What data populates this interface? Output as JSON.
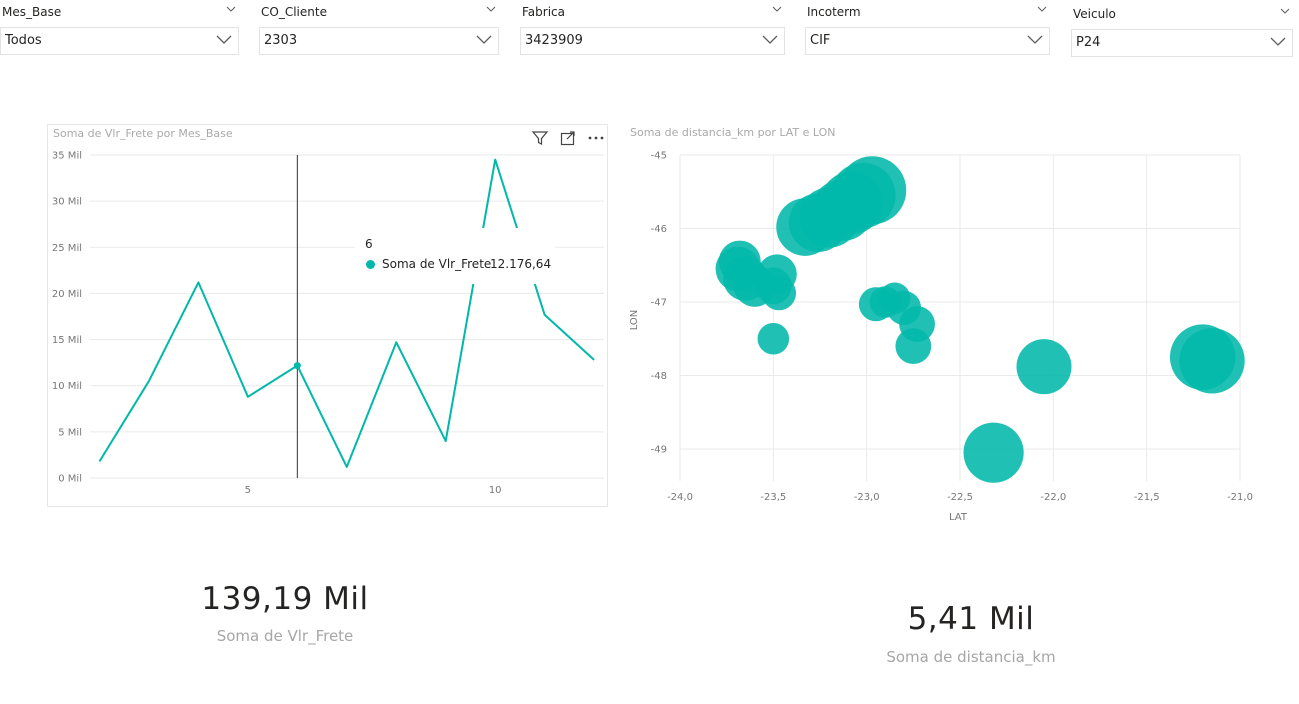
{
  "slicers": [
    {
      "label": "Mes_Base",
      "value": "Todos"
    },
    {
      "label": "CO_Cliente",
      "value": "2303"
    },
    {
      "label": "Fabrica",
      "value": "3423909"
    },
    {
      "label": "Incoterm",
      "value": "CIF"
    },
    {
      "label": "Veiculo",
      "value": "P24"
    }
  ],
  "line_chart": {
    "title": "Soma de Vlr_Frete por Mes_Base",
    "tooltip": {
      "header": "6",
      "series": "Soma de Vlr_Frete",
      "value": "12.176,64"
    }
  },
  "scatter_chart": {
    "title": "Soma de distancia_km por LAT e LON"
  },
  "cards": [
    {
      "value": "139,19 Mil",
      "label": "Soma de Vlr_Frete"
    },
    {
      "value": "5,41 Mil",
      "label": "Soma de distancia_km"
    }
  ],
  "colors": {
    "accent": "#01b8aa"
  },
  "icons": [
    "chevron-down-icon",
    "filter-icon",
    "focus-mode-icon",
    "more-options-icon"
  ],
  "chart_data": [
    {
      "type": "line",
      "title": "Soma de Vlr_Frete por Mes_Base",
      "x": [
        2,
        3,
        4,
        5,
        6,
        7,
        8,
        9,
        10,
        11,
        12
      ],
      "series": [
        {
          "name": "Soma de Vlr_Frete",
          "values": [
            1800,
            10500,
            21200,
            8800,
            12176.64,
            1200,
            14700,
            4000,
            34500,
            17700,
            12800
          ]
        }
      ],
      "xticks": [
        "5",
        "10"
      ],
      "yticks": [
        "0 Mil",
        "5 Mil",
        "10 Mil",
        "15 Mil",
        "20 Mil",
        "25 Mil",
        "30 Mil",
        "35 Mil"
      ],
      "xlim": [
        1.95,
        12.2
      ],
      "ylim": [
        0,
        35000
      ],
      "grid": true
    },
    {
      "type": "scatter",
      "title": "Soma de distancia_km por LAT e LON",
      "xlabel": "LAT",
      "ylabel": "LON",
      "xticks": [
        "-24,0",
        "-23,5",
        "-23,0",
        "-22,5",
        "-22,0",
        "-21,5",
        "-21,0"
      ],
      "yticks": [
        "-45",
        "-46",
        "-47",
        "-48",
        "-49"
      ],
      "xlim": [
        -24.0,
        -21.0
      ],
      "ylim": [
        -49.4,
        -45.0
      ],
      "grid": true,
      "points": [
        {
          "lat": -22.97,
          "lon": -45.48,
          "size": 1.0
        },
        {
          "lat": -23.02,
          "lon": -45.55,
          "size": 0.95
        },
        {
          "lat": -23.08,
          "lon": -45.65,
          "size": 0.9
        },
        {
          "lat": -23.13,
          "lon": -45.75,
          "size": 0.88
        },
        {
          "lat": -23.2,
          "lon": -45.85,
          "size": 0.85
        },
        {
          "lat": -23.26,
          "lon": -45.92,
          "size": 0.82
        },
        {
          "lat": -23.33,
          "lon": -45.98,
          "size": 0.8
        },
        {
          "lat": -23.68,
          "lon": -46.45,
          "size": 0.5
        },
        {
          "lat": -23.69,
          "lon": -46.55,
          "size": 0.55
        },
        {
          "lat": -23.65,
          "lon": -46.68,
          "size": 0.55
        },
        {
          "lat": -23.6,
          "lon": -46.78,
          "size": 0.5
        },
        {
          "lat": -23.5,
          "lon": -46.78,
          "size": 0.4
        },
        {
          "lat": -23.48,
          "lon": -46.62,
          "size": 0.45
        },
        {
          "lat": -23.47,
          "lon": -46.88,
          "size": 0.35
        },
        {
          "lat": -23.5,
          "lon": -47.5,
          "size": 0.3
        },
        {
          "lat": -22.95,
          "lon": -47.03,
          "size": 0.35
        },
        {
          "lat": -22.9,
          "lon": -47.0,
          "size": 0.3
        },
        {
          "lat": -22.85,
          "lon": -46.95,
          "size": 0.3
        },
        {
          "lat": -22.8,
          "lon": -47.08,
          "size": 0.35
        },
        {
          "lat": -22.73,
          "lon": -47.3,
          "size": 0.38
        },
        {
          "lat": -22.75,
          "lon": -47.6,
          "size": 0.38
        },
        {
          "lat": -22.32,
          "lon": -49.05,
          "size": 0.85
        },
        {
          "lat": -22.05,
          "lon": -47.88,
          "size": 0.75
        },
        {
          "lat": -21.2,
          "lon": -47.75,
          "size": 0.95
        },
        {
          "lat": -21.15,
          "lon": -47.8,
          "size": 0.95
        }
      ]
    }
  ]
}
